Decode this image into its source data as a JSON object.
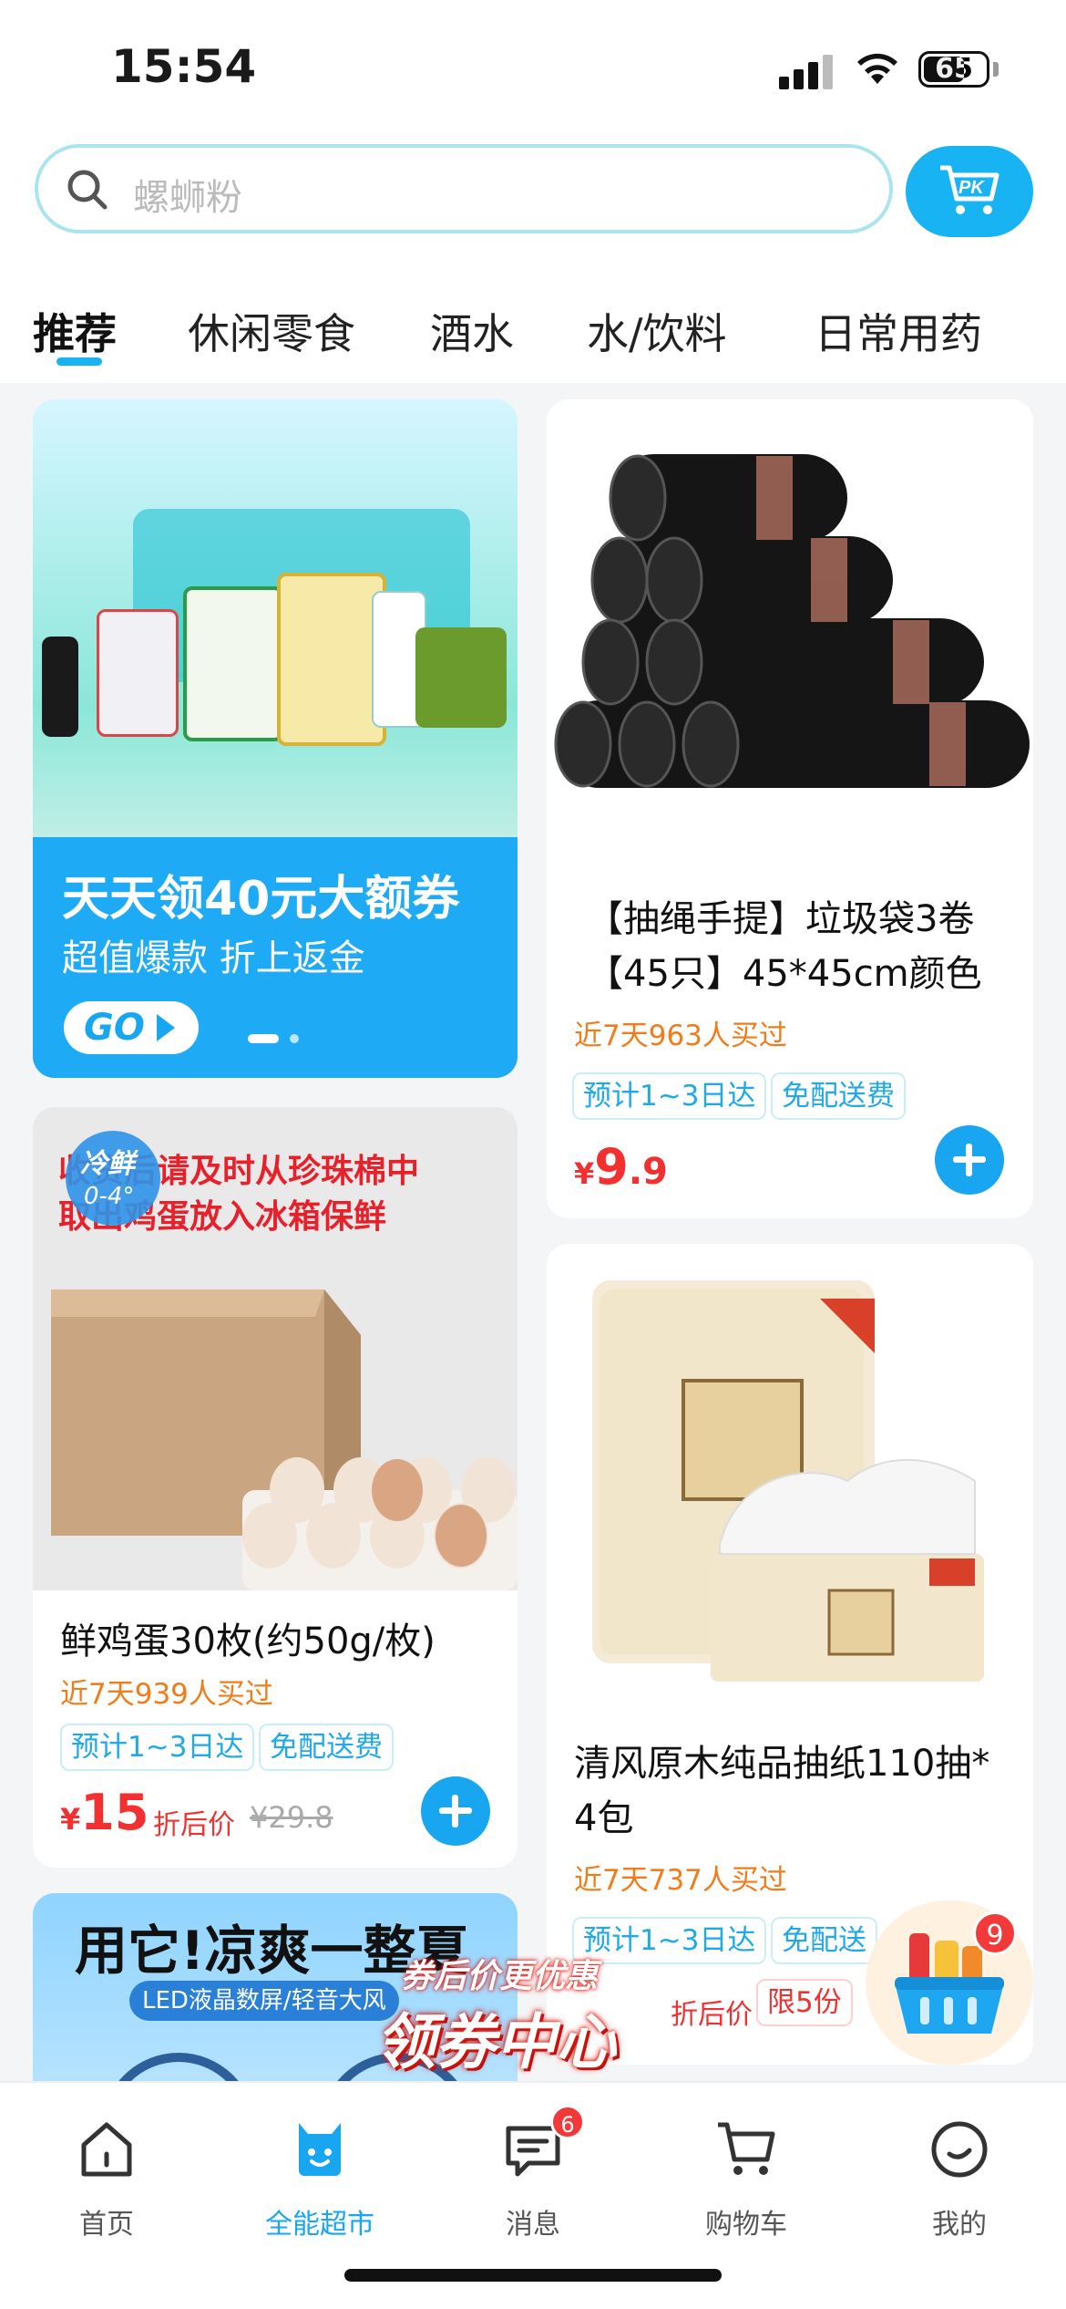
{
  "status": {
    "time": "15:54",
    "battery": "65"
  },
  "search": {
    "placeholder": "螺蛳粉",
    "pk_label": "PK"
  },
  "tabs": [
    {
      "label": "推荐",
      "active": true
    },
    {
      "label": "休闲零食"
    },
    {
      "label": "酒水"
    },
    {
      "label": "水/饮料"
    },
    {
      "label": "日常用药"
    }
  ],
  "banner": {
    "title": "天天领40元大额券",
    "subtitle": "超值爆款 折上返金",
    "go_label": "GO"
  },
  "products": [
    {
      "title_line1": "【抽绳手提】垃圾袋3卷",
      "title_line2": "【45只】45*45cm颜色",
      "sold": "近7天963人买过",
      "tags": [
        "预计1~3日达",
        "免配送费"
      ],
      "currency": "¥",
      "price_int": "9",
      "price_dec": ".9"
    },
    {
      "overlay_text_line1": "收货后请及时从珍珠棉中",
      "overlay_text_line2": "取出鸡蛋放入冰箱保鲜",
      "fresh_badge": "冷鲜",
      "fresh_temp": "0-4°",
      "title": "鲜鸡蛋30枚(约50g/枚)",
      "sold": "近7天939人买过",
      "tags": [
        "预计1~3日达",
        "免配送费"
      ],
      "currency": "¥",
      "price_int": "15",
      "price_note": "折后价",
      "price_old": "¥29.8"
    },
    {
      "title_line1": "清风原木纯品抽纸110抽*",
      "title_line2": "4包",
      "sold": "近7天737人买过",
      "tags": [
        "预计1~3日达",
        "免配送"
      ],
      "price_note": "折后价",
      "limit": "限5份"
    },
    {
      "banner_title": "用它!凉爽一整夏",
      "banner_sub": "LED液晶数屏/轻音大风"
    }
  ],
  "coupon_float": {
    "top": "券后价更优惠",
    "main": "领券中心"
  },
  "float_cart": {
    "badge": "9"
  },
  "nav": [
    {
      "label": "首页"
    },
    {
      "label": "全能超市",
      "active": true
    },
    {
      "label": "消息",
      "badge": "6"
    },
    {
      "label": "购物车"
    },
    {
      "label": "我的"
    }
  ],
  "colors": {
    "accent": "#18a6f0",
    "price": "#f23030",
    "sold": "#f27b1a"
  }
}
